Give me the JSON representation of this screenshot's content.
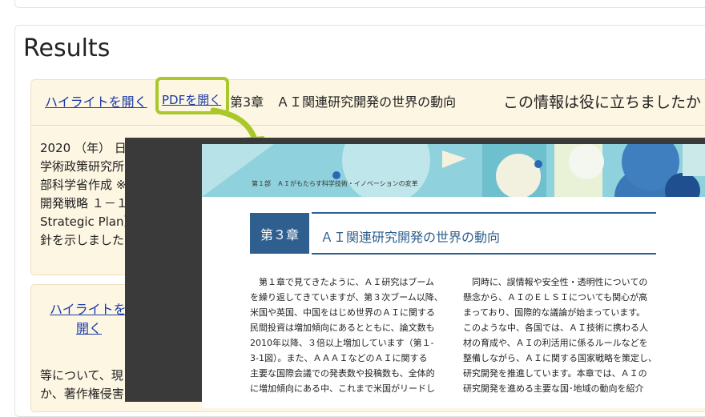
{
  "results_heading": "Results",
  "card1": {
    "highlight_link": "ハイライトを開く",
    "pdf_link": "PDFを開く",
    "doc_title": "第3章　ＡＩ関連研究開発の世界の動向",
    "feedback_question": "この情報は役に立ちましたか",
    "snippet_lines": [
      "2020 （年） 日",
      "学術政策研究所",
      "部科学省作成 ※",
      "開発戦略 １－１",
      "Strategic Plan）",
      "針を示しました"
    ]
  },
  "card2": {
    "highlight_link_1": "ハイライトを",
    "highlight_link_2": "開く",
    "snippet_lines": [
      "等について、現",
      "か、著作権侵害"
    ]
  },
  "pdf_viewer": {
    "banner_text": "第１部　ＡＩがもたらす科学技術・イノベーションの変革",
    "chapter_badge": "第３章",
    "chapter_title": "ＡＩ関連研究開発の世界の動向",
    "left_column": [
      "　第１章で見てきたように、ＡＩ研究はブーム",
      "を繰り返してきていますが、第３次ブーム以降、",
      "米国や英国、中国をはじめ世界のＡＩに関する",
      "民間投資は増加傾向にあるとともに、論文数も",
      "2010年以降、３倍以上増加しています（第１-",
      "3-1図）。また、ＡＡＡＩなどのＡＩに関する",
      "主要な国際会議での発表数や投稿数も、全体的",
      "に増加傾向にある中、これまで米国がリードし"
    ],
    "right_column": [
      "　同時に、誤情報や安全性・透明性についての",
      "懸念から、ＡＩのＥＬＳＩについても関心が高",
      "まっており、国際的な議論が始まっています。",
      "このような中、各国では、ＡＩ技術に携わる人",
      "材の育成や、ＡＩの利活用に係るルールなどを",
      "整備しながら、ＡＩに関する国家戦略を策定し、",
      "研究開発を推進しています。本章では、ＡＩの",
      "研究開発を進める主要な国･地域の動向を紹介"
    ]
  },
  "colors": {
    "card_bg": "#fdf6e3",
    "link": "#1a3aa6",
    "highlight_border": "#a9c92b",
    "chapter_blue": "#2e5f8f"
  }
}
